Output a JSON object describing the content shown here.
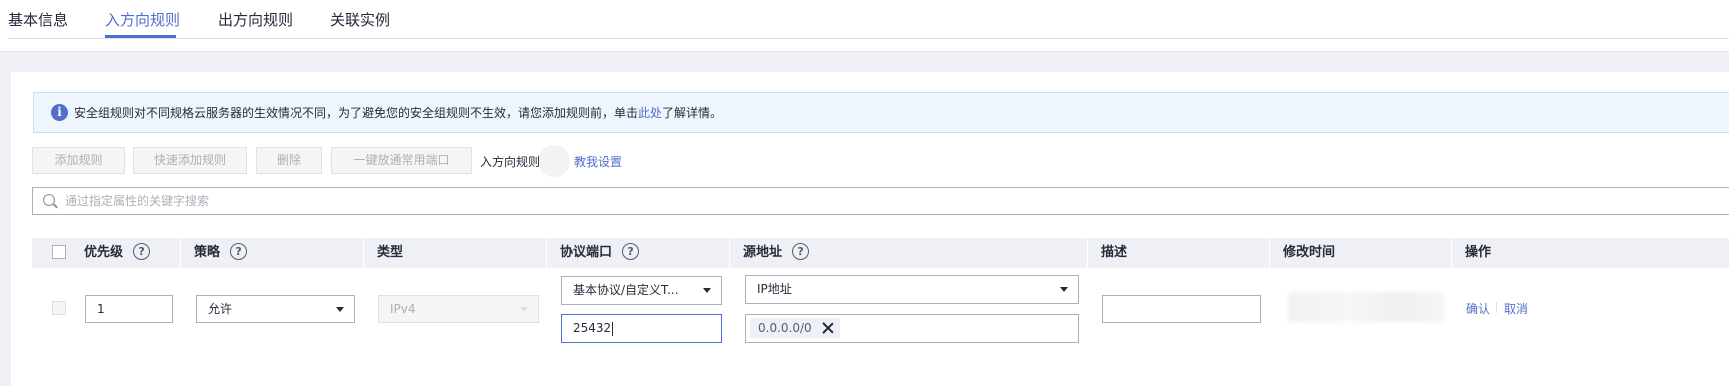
{
  "tabs": [
    {
      "label": "基本信息",
      "active": false
    },
    {
      "label": "入方向规则",
      "active": true
    },
    {
      "label": "出方向规则",
      "active": false
    },
    {
      "label": "关联实例",
      "active": false
    }
  ],
  "banner": {
    "icon": "info-icon",
    "text_before": "安全组规则对不同规格云服务器的生效情况不同，为了避免您的安全组规则不生效，请您添加规则前，单击",
    "link": "此处",
    "text_after": "了解详情。"
  },
  "toolbar": {
    "add_rule": "添加规则",
    "quick_add_rule": "快速添加规则",
    "delete": "删除",
    "open_common_ports": "一键放通常用端口",
    "direction_label": "入方向规则",
    "teach_me": "教我设置"
  },
  "search": {
    "placeholder": "通过指定属性的关键字搜索"
  },
  "table": {
    "headers": {
      "priority": "优先级",
      "policy": "策略",
      "type": "类型",
      "protocol_port": "协议端口",
      "source": "源地址",
      "description": "描述",
      "modified_time": "修改时间",
      "actions": "操作"
    },
    "help_glyph": "?",
    "edit_row": {
      "priority": "1",
      "policy": "允许",
      "type": "IPv4",
      "protocol": "基本协议/自定义T...",
      "port": "25432",
      "source_type": "IP地址",
      "source_tag": "0.0.0.0/0",
      "description": "",
      "confirm": "确认",
      "cancel": "取消"
    }
  },
  "colors": {
    "accent": "#526ecc",
    "header_bg": "#eef0f5",
    "banner_bg": "#eff5fd"
  }
}
